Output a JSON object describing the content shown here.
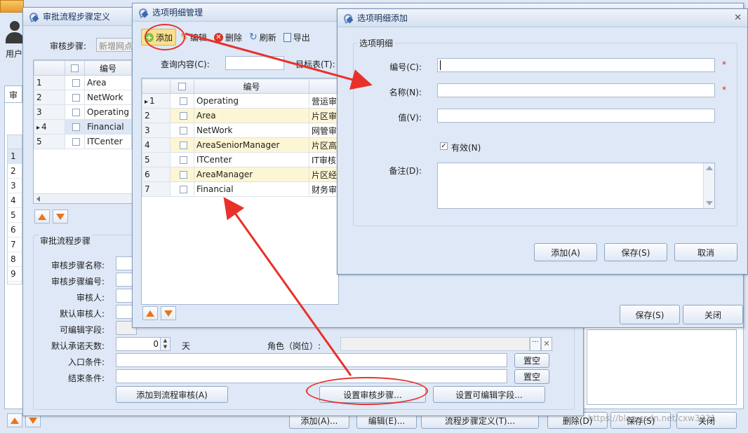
{
  "bg": {
    "user_label": "用户",
    "tab_label": "审",
    "bottom_buttons": [
      "添加(A)...",
      "编辑(E)...",
      "流程步骤定义(T)...",
      "删除(D)",
      "保存(S)",
      "关闭"
    ],
    "left_grid_rows": [
      "1",
      "2",
      "3",
      "4",
      "5",
      "6",
      "7",
      "8",
      "9"
    ],
    "left_grid_first_row_indicator": "1"
  },
  "step_window": {
    "title": "审批流程步骤定义",
    "step_label": "审核步骤:",
    "step_input": "新增网点",
    "grid_header": "编号",
    "rows": [
      {
        "n": "1",
        "code": "Area"
      },
      {
        "n": "2",
        "code": "NetWork"
      },
      {
        "n": "3",
        "code": "Operating"
      },
      {
        "n": "4",
        "code": "Financial"
      },
      {
        "n": "5",
        "code": "ITCenter"
      }
    ],
    "group_title": "审批流程步骤",
    "fields": {
      "step_name": "审核步骤名称:",
      "step_code": "审核步骤编号:",
      "approver": "审核人:",
      "default_approver": "默认审核人:",
      "editable_fields": "可编辑字段:",
      "default_days": "默认承诺天数:",
      "days_value": "0",
      "days_unit": "天",
      "role": "角色（岗位）:",
      "entry": "入口条件:",
      "end": "结束条件:"
    },
    "clear_label": "置空",
    "add_to_flow": "添加到流程审核(A)",
    "set_step": "设置审核步骤...",
    "set_fields": "设置可编辑字段..."
  },
  "detail_window": {
    "title": "选项明细管理",
    "toolbar": {
      "add": "添加",
      "edit": "编辑",
      "delete": "删除",
      "refresh": "刷新",
      "export": "导出"
    },
    "query_label": "查询内容(C):",
    "target_label": "目标表(T):",
    "grid_header": "编号",
    "rows": [
      {
        "n": "1",
        "code": "Operating",
        "desc": "营运审"
      },
      {
        "n": "2",
        "code": "Area",
        "desc": "片区审"
      },
      {
        "n": "3",
        "code": "NetWork",
        "desc": "网管审"
      },
      {
        "n": "4",
        "code": "AreaSeniorManager",
        "desc": "片区高"
      },
      {
        "n": "5",
        "code": "ITCenter",
        "desc": "IT审核"
      },
      {
        "n": "6",
        "code": "AreaManager",
        "desc": "片区经"
      },
      {
        "n": "7",
        "code": "Financial",
        "desc": "财务审"
      }
    ],
    "save": "保存(S)",
    "close": "关闭"
  },
  "add_window": {
    "title": "选项明细添加",
    "group_title": "选项明细",
    "code_label": "编号(C):",
    "name_label": "名称(N):",
    "value_label": "值(V):",
    "valid_label": "有效(N)",
    "remark_label": "备注(D):",
    "required_mark": "*",
    "add": "添加(A)",
    "save": "保存(S)",
    "cancel": "取消"
  },
  "watermark": "https://blog.csdn.net/cxw3321",
  "colors": {
    "annotation": "#e8312a",
    "highlight_row": "#fdf6d4",
    "title_text": "#15305c"
  }
}
